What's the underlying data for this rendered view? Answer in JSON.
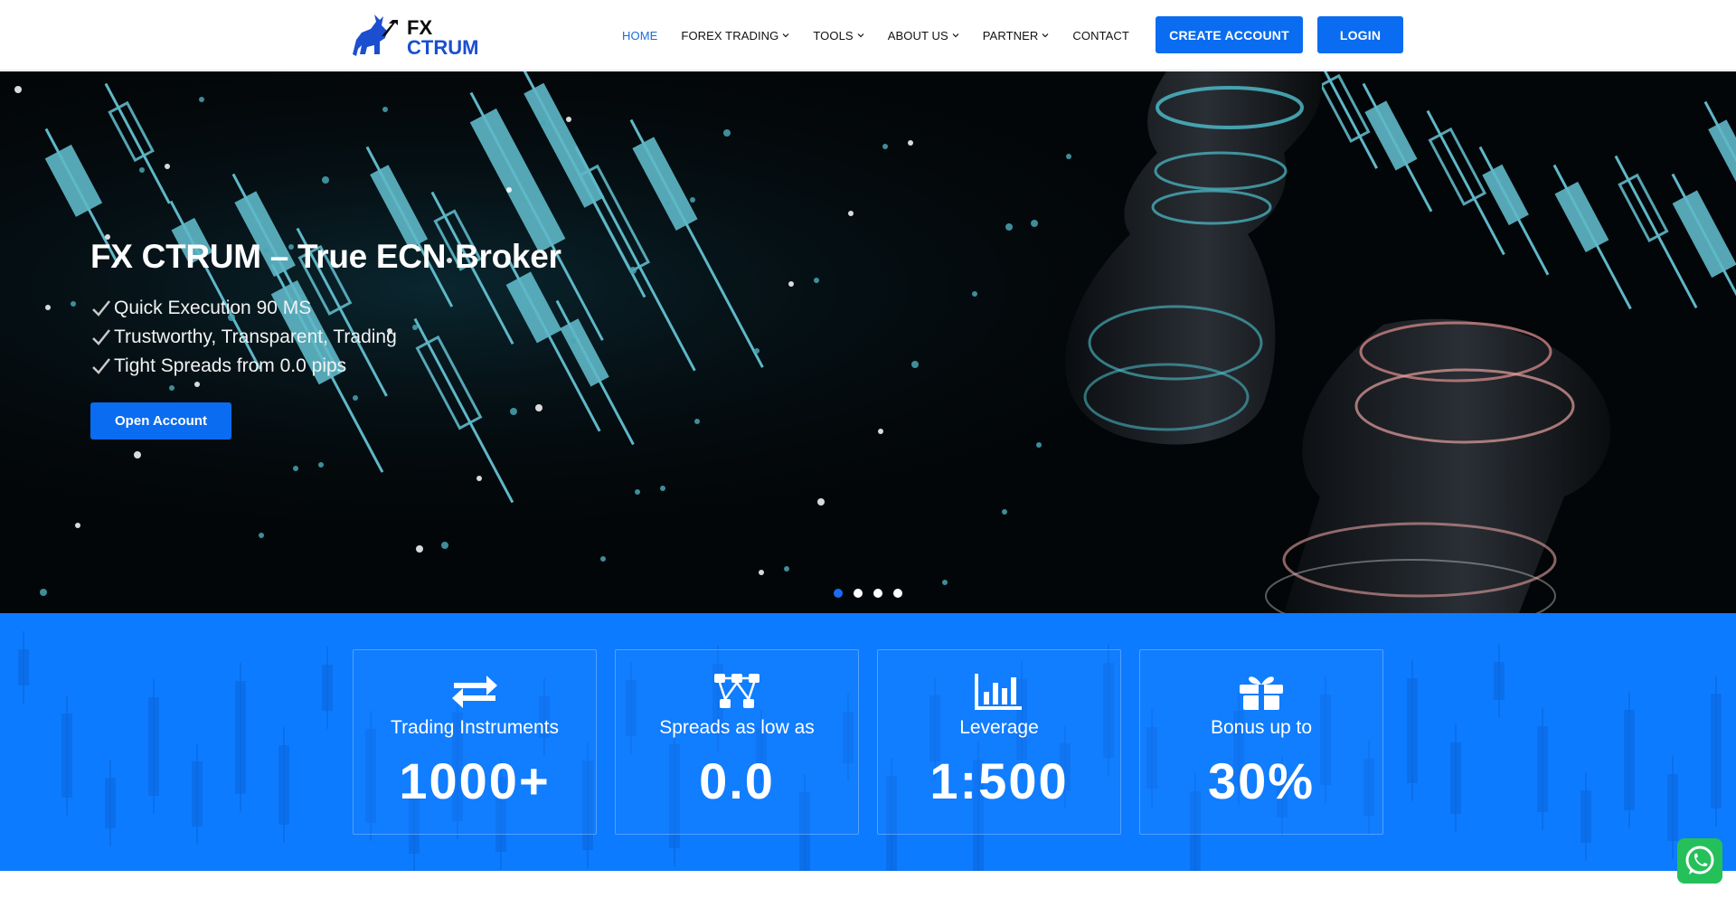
{
  "header": {
    "logo": {
      "line1": "FX",
      "line2": "CTRUM",
      "icon": "bull-logo-icon"
    },
    "nav": [
      {
        "label": "HOME",
        "active": true,
        "dropdown": false
      },
      {
        "label": "FOREX TRADING",
        "active": false,
        "dropdown": true
      },
      {
        "label": "TOOLS",
        "active": false,
        "dropdown": true
      },
      {
        "label": "ABOUT US",
        "active": false,
        "dropdown": true
      },
      {
        "label": "PARTNER",
        "active": false,
        "dropdown": true
      },
      {
        "label": "CONTACT",
        "active": false,
        "dropdown": false
      }
    ],
    "create_account_label": "CREATE ACCOUNT",
    "login_label": "LOGIN"
  },
  "hero": {
    "title": "FX CTRUM – True ECN Broker",
    "bullets": [
      "Quick Execution 90 MS",
      "Trustworthy, Transparent, Trading",
      "Tight Spreads from 0.0 pips"
    ],
    "cta_label": "Open Account",
    "slides_total": 4,
    "slide_active": 1
  },
  "stats": [
    {
      "label": "Trading Instruments",
      "value": "1000+",
      "icon": "exchange-arrows-icon"
    },
    {
      "label": "Spreads as low as",
      "value": "0.0",
      "icon": "network-nodes-icon"
    },
    {
      "label": "Leverage",
      "value": "1:500",
      "icon": "bar-chart-icon"
    },
    {
      "label": "Bonus up to",
      "value": "30%",
      "icon": "gift-icon"
    }
  ],
  "colors": {
    "accent": "#0a6cf0",
    "stats_bg": "#0d7bff",
    "nav_active": "#1a6cd8",
    "hero_bg": "#030608",
    "whatsapp": "#25c05a"
  },
  "widgets": {
    "whatsapp_icon": "whatsapp-icon"
  }
}
